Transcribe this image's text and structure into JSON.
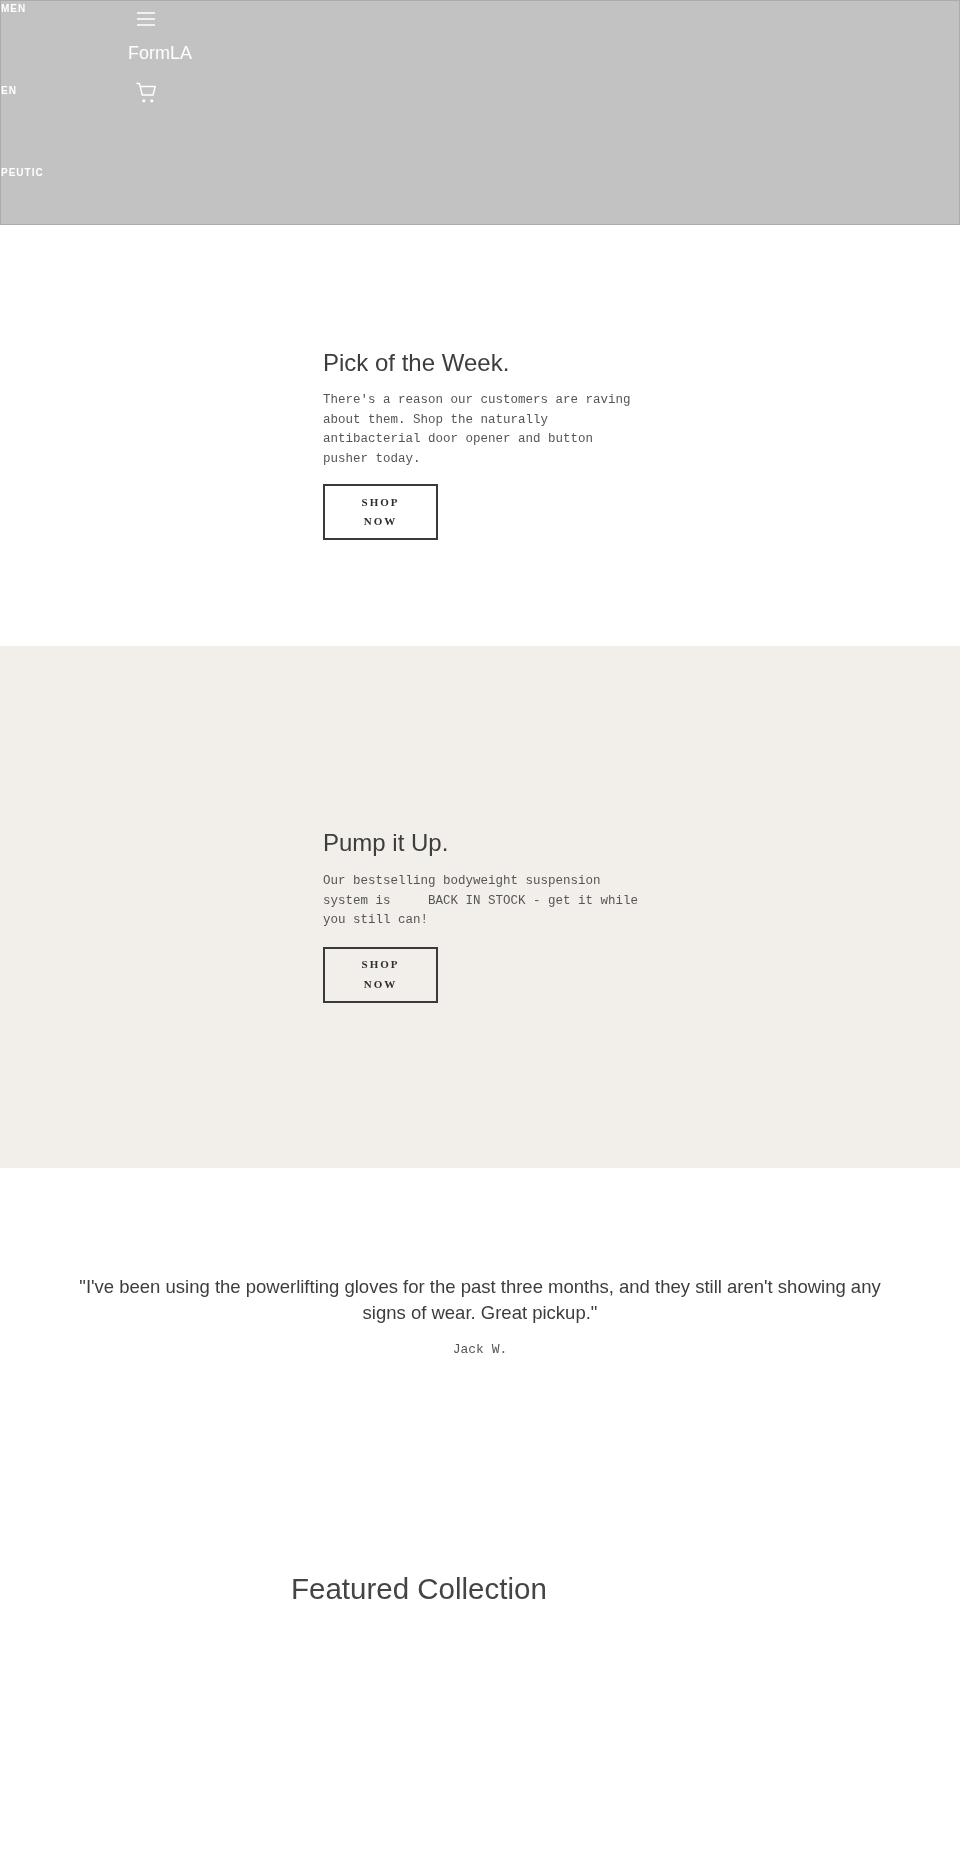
{
  "header": {
    "nav_items": [
      "MEN",
      "EN",
      "PEUTIC"
    ],
    "brand": "FormLA"
  },
  "promos": [
    {
      "title": "Pick of the Week.",
      "text": "There's a reason our customers are raving about them. Shop the naturally antibacterial door opener and button pusher today.",
      "button": "SHOP NOW"
    },
    {
      "title": "Pump it Up.",
      "text": "Our bestselling bodyweight suspension system is     BACK IN STOCK - get it while you still can!",
      "button": "SHOP NOW"
    }
  ],
  "testimonial": {
    "quote": "\"I've been using the powerlifting gloves for the past three months, and they still aren't showing any signs of wear. Great pickup.\"",
    "author": "Jack W."
  },
  "featured_collection": {
    "title": "Featured Collection"
  }
}
